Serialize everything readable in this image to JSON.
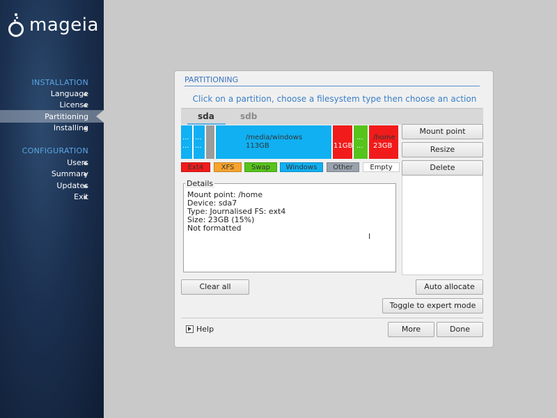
{
  "brand": {
    "logo_text": "mageia"
  },
  "sidebar": {
    "sections": [
      {
        "title": "INSTALLATION",
        "items": [
          "Language",
          "License",
          "Partitioning",
          "Installing"
        ]
      },
      {
        "title": "CONFIGURATION",
        "items": [
          "Users",
          "Summary",
          "Updates",
          "Exit"
        ]
      }
    ],
    "active_item": "Partitioning"
  },
  "dialog": {
    "title": "PARTITIONING",
    "instruction": "Click on a partition, choose a filesystem type then choose an action",
    "tabs": [
      {
        "label": "sda",
        "selected": true
      },
      {
        "label": "sdb",
        "selected": false
      }
    ],
    "partitions": [
      {
        "type": "Windows",
        "label": "...",
        "label2": "..."
      },
      {
        "type": "Windows",
        "label": "...",
        "label2": "..."
      },
      {
        "type": "Empty",
        "label": ""
      },
      {
        "type": "Windows",
        "label": "/media/windows",
        "label2": "113GB"
      },
      {
        "type": "Ext4",
        "label": "11GB"
      },
      {
        "type": "Swap",
        "label": "...",
        "label2": "..."
      },
      {
        "type": "Ext4",
        "label": "/home",
        "label2": "23GB",
        "selected": true
      }
    ],
    "legend": [
      {
        "label": "Ext4",
        "color": "#f11b1b"
      },
      {
        "label": "XFS",
        "color": "#f7a32e"
      },
      {
        "label": "Swap",
        "color": "#56c41c"
      },
      {
        "label": "Windows",
        "color": "#10b0f2"
      },
      {
        "label": "Other",
        "color": "#9aa3ad"
      },
      {
        "label": "Empty",
        "color": "#ffffff"
      }
    ],
    "actions": {
      "mount_point": "Mount point",
      "resize": "Resize",
      "delete": "Delete"
    },
    "details": {
      "label": "Details",
      "lines": "Mount point: /home\nDevice: sda7\nType: Journalised FS: ext4\nSize: 23GB (15%)\nNot formatted",
      "cursor_glyph": "I"
    },
    "buttons": {
      "clear_all": "Clear all",
      "auto_allocate": "Auto allocate",
      "toggle_expert": "Toggle to expert mode",
      "help": "Help",
      "more": "More",
      "done": "Done"
    }
  }
}
